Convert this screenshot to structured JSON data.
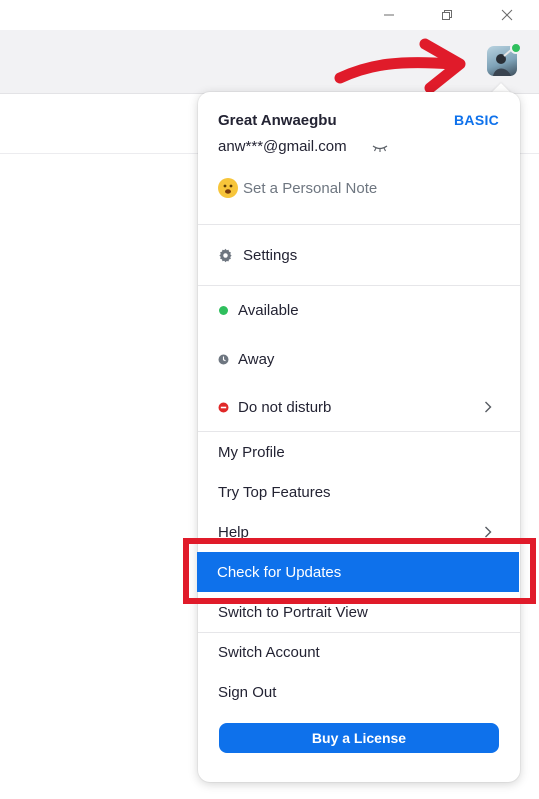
{
  "window": {
    "icons": {
      "minimize": "minimize-icon",
      "maximize": "restore-icon",
      "close": "close-icon"
    }
  },
  "header": {
    "avatar_status_color": "#2fbf5d"
  },
  "profile": {
    "name": "Great Anwaegbu",
    "plan": "BASIC",
    "email": "anw***@gmail.com",
    "personal_note": "Set a Personal Note"
  },
  "menu": {
    "settings": "Settings",
    "status": {
      "available": "Available",
      "away": "Away",
      "dnd": "Do not disturb"
    },
    "my_profile": "My Profile",
    "try_top_features": "Try Top Features",
    "help": "Help",
    "check_for_updates": "Check for Updates",
    "switch_portrait": "Switch to Portrait View",
    "switch_account": "Switch Account",
    "sign_out": "Sign Out",
    "buy_license": "Buy a License"
  },
  "colors": {
    "accent": "#0e71eb",
    "available": "#2fbf5d",
    "away": "#6e7680",
    "dnd": "#e02828",
    "annotation": "#e01b2a"
  }
}
